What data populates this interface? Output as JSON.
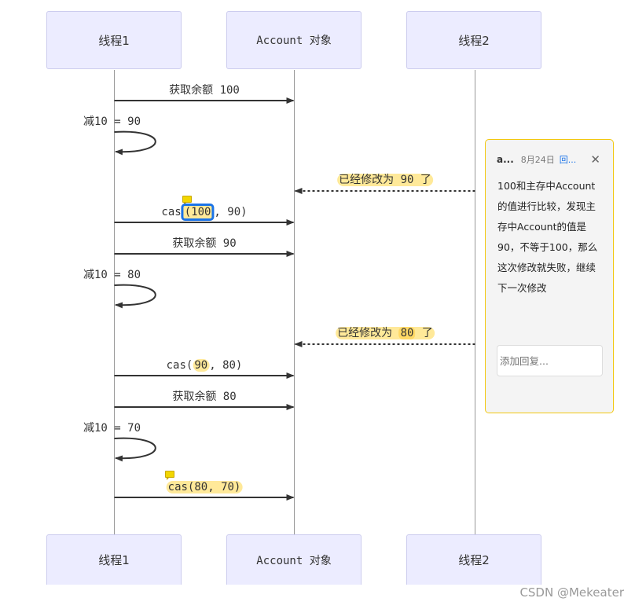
{
  "actors": [
    {
      "id": "thread1",
      "label": "线程1"
    },
    {
      "id": "account",
      "label": "Account 对象"
    },
    {
      "id": "thread2",
      "label": "线程2"
    }
  ],
  "messages": [
    {
      "from": "thread1",
      "to": "account",
      "label": "获取余额 100",
      "style": "solid"
    },
    {
      "from": "thread1",
      "to": "thread1",
      "label": "减10 = 90",
      "style": "self"
    },
    {
      "from": "thread2",
      "to": "account",
      "label_pre": "已经修改为 ",
      "label_hl": "90",
      "label_post": " 了",
      "style": "dashed",
      "highlight": "full"
    },
    {
      "from": "thread1",
      "to": "account",
      "label_pre": "cas",
      "label_hl": "(100",
      "label_post": ", 90)",
      "style": "solid",
      "highlight": "selected",
      "has_comment": true
    },
    {
      "from": "thread1",
      "to": "account",
      "label": "获取余额 90",
      "style": "solid"
    },
    {
      "from": "thread1",
      "to": "thread1",
      "label": "减10 = 80",
      "style": "self"
    },
    {
      "from": "thread2",
      "to": "account",
      "label_pre": "已经修改为 ",
      "label_hl": "80",
      "label_post": " 了",
      "style": "dashed",
      "highlight": "full"
    },
    {
      "from": "thread1",
      "to": "account",
      "label_pre": "cas(",
      "label_hl": "90",
      "label_post": ", 80)",
      "style": "solid",
      "highlight": "partial"
    },
    {
      "from": "thread1",
      "to": "account",
      "label": "获取余额 80",
      "style": "solid"
    },
    {
      "from": "thread1",
      "to": "thread1",
      "label": "减10 = 70",
      "style": "self"
    },
    {
      "from": "thread1",
      "to": "account",
      "label": "cas(80, 70)",
      "style": "solid",
      "highlight": "full-label",
      "has_comment": true
    }
  ],
  "comment": {
    "author": "a...",
    "date": "8月24日",
    "reply_link": "回...",
    "close_icon": "close-icon",
    "body": "100和主存中Account的值进行比较，发现主存中Account的值是90，不等于100，那么这次修改就失败，继续下一次修改",
    "reply_placeholder": "添加回复..."
  },
  "footer": {
    "watermark": "CSDN @Mekeater"
  },
  "colors": {
    "actor_fill": "#ECECFF",
    "actor_border": "#CCCCEE",
    "highlight": "#FFE999",
    "selection": "#1A73E8",
    "comment_border": "#F2C811"
  }
}
